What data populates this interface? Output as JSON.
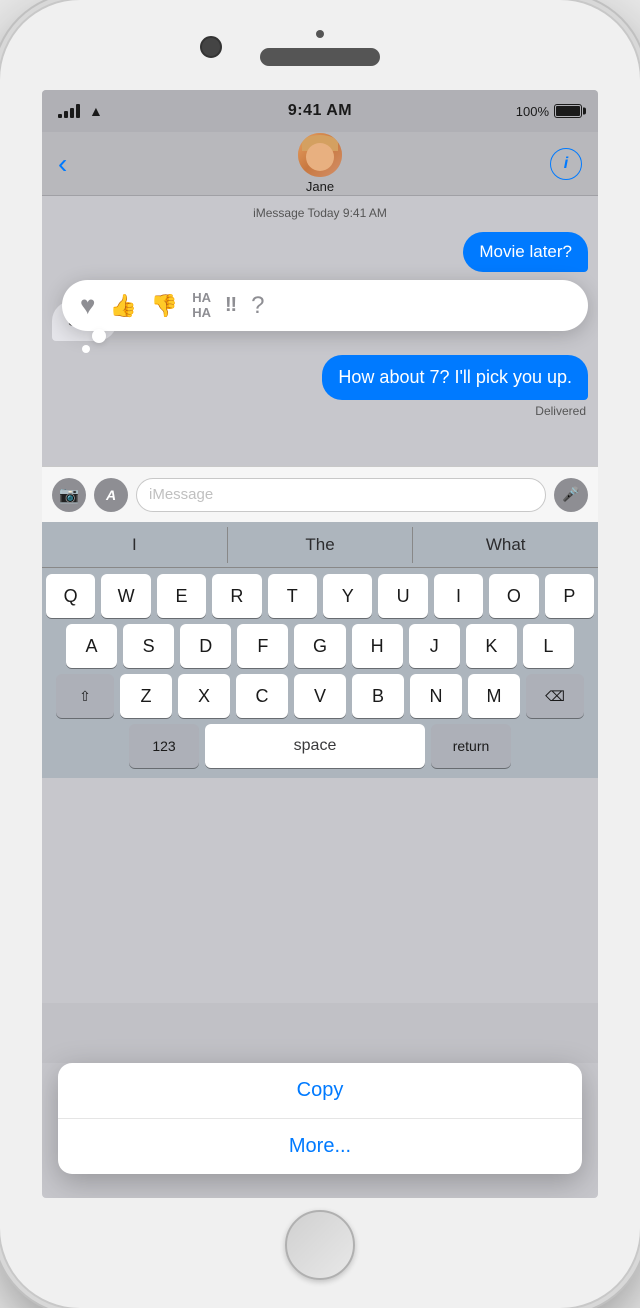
{
  "phone": {
    "status_bar": {
      "time": "9:41 AM",
      "battery_label": "100%",
      "signal_bars": [
        4,
        8,
        11,
        14
      ],
      "wifi": "wifi"
    },
    "nav": {
      "back_label": "‹",
      "contact_name": "Jane",
      "info_label": "i"
    },
    "messages": {
      "date_label": "iMessage\nToday 9:41 AM",
      "bubble1": "Movie later?",
      "bubble2_cut": "Sur",
      "bubble3": "How about 7? I'll pick you up.",
      "delivered": "Delivered"
    },
    "reactions": {
      "heart": "♥",
      "thumbs_up": "👍",
      "thumbs_down": "👎",
      "haha": "HA\nHA",
      "exclaim": "‼",
      "question": "?"
    },
    "input": {
      "placeholder": "iMessage",
      "camera_icon": "📷",
      "app_icon": "A",
      "mic_icon": "🎤"
    },
    "predictive": {
      "item1": "I",
      "item2": "The",
      "item3": "What"
    },
    "keyboard": {
      "row1": [
        "Q",
        "W",
        "E",
        "R",
        "T",
        "Y",
        "U",
        "I",
        "O",
        "P"
      ],
      "row2": [
        "A",
        "S",
        "D",
        "F",
        "G",
        "H",
        "J",
        "K",
        "L"
      ],
      "row3_extra_left": "⇧",
      "row3": [
        "Z",
        "X",
        "C",
        "V",
        "B",
        "N",
        "M"
      ],
      "row3_extra_right": "⌫",
      "row4": {
        "numbers": "123",
        "space": "space",
        "return": "return"
      }
    },
    "context_menu": {
      "copy": "Copy",
      "more": "More..."
    }
  }
}
